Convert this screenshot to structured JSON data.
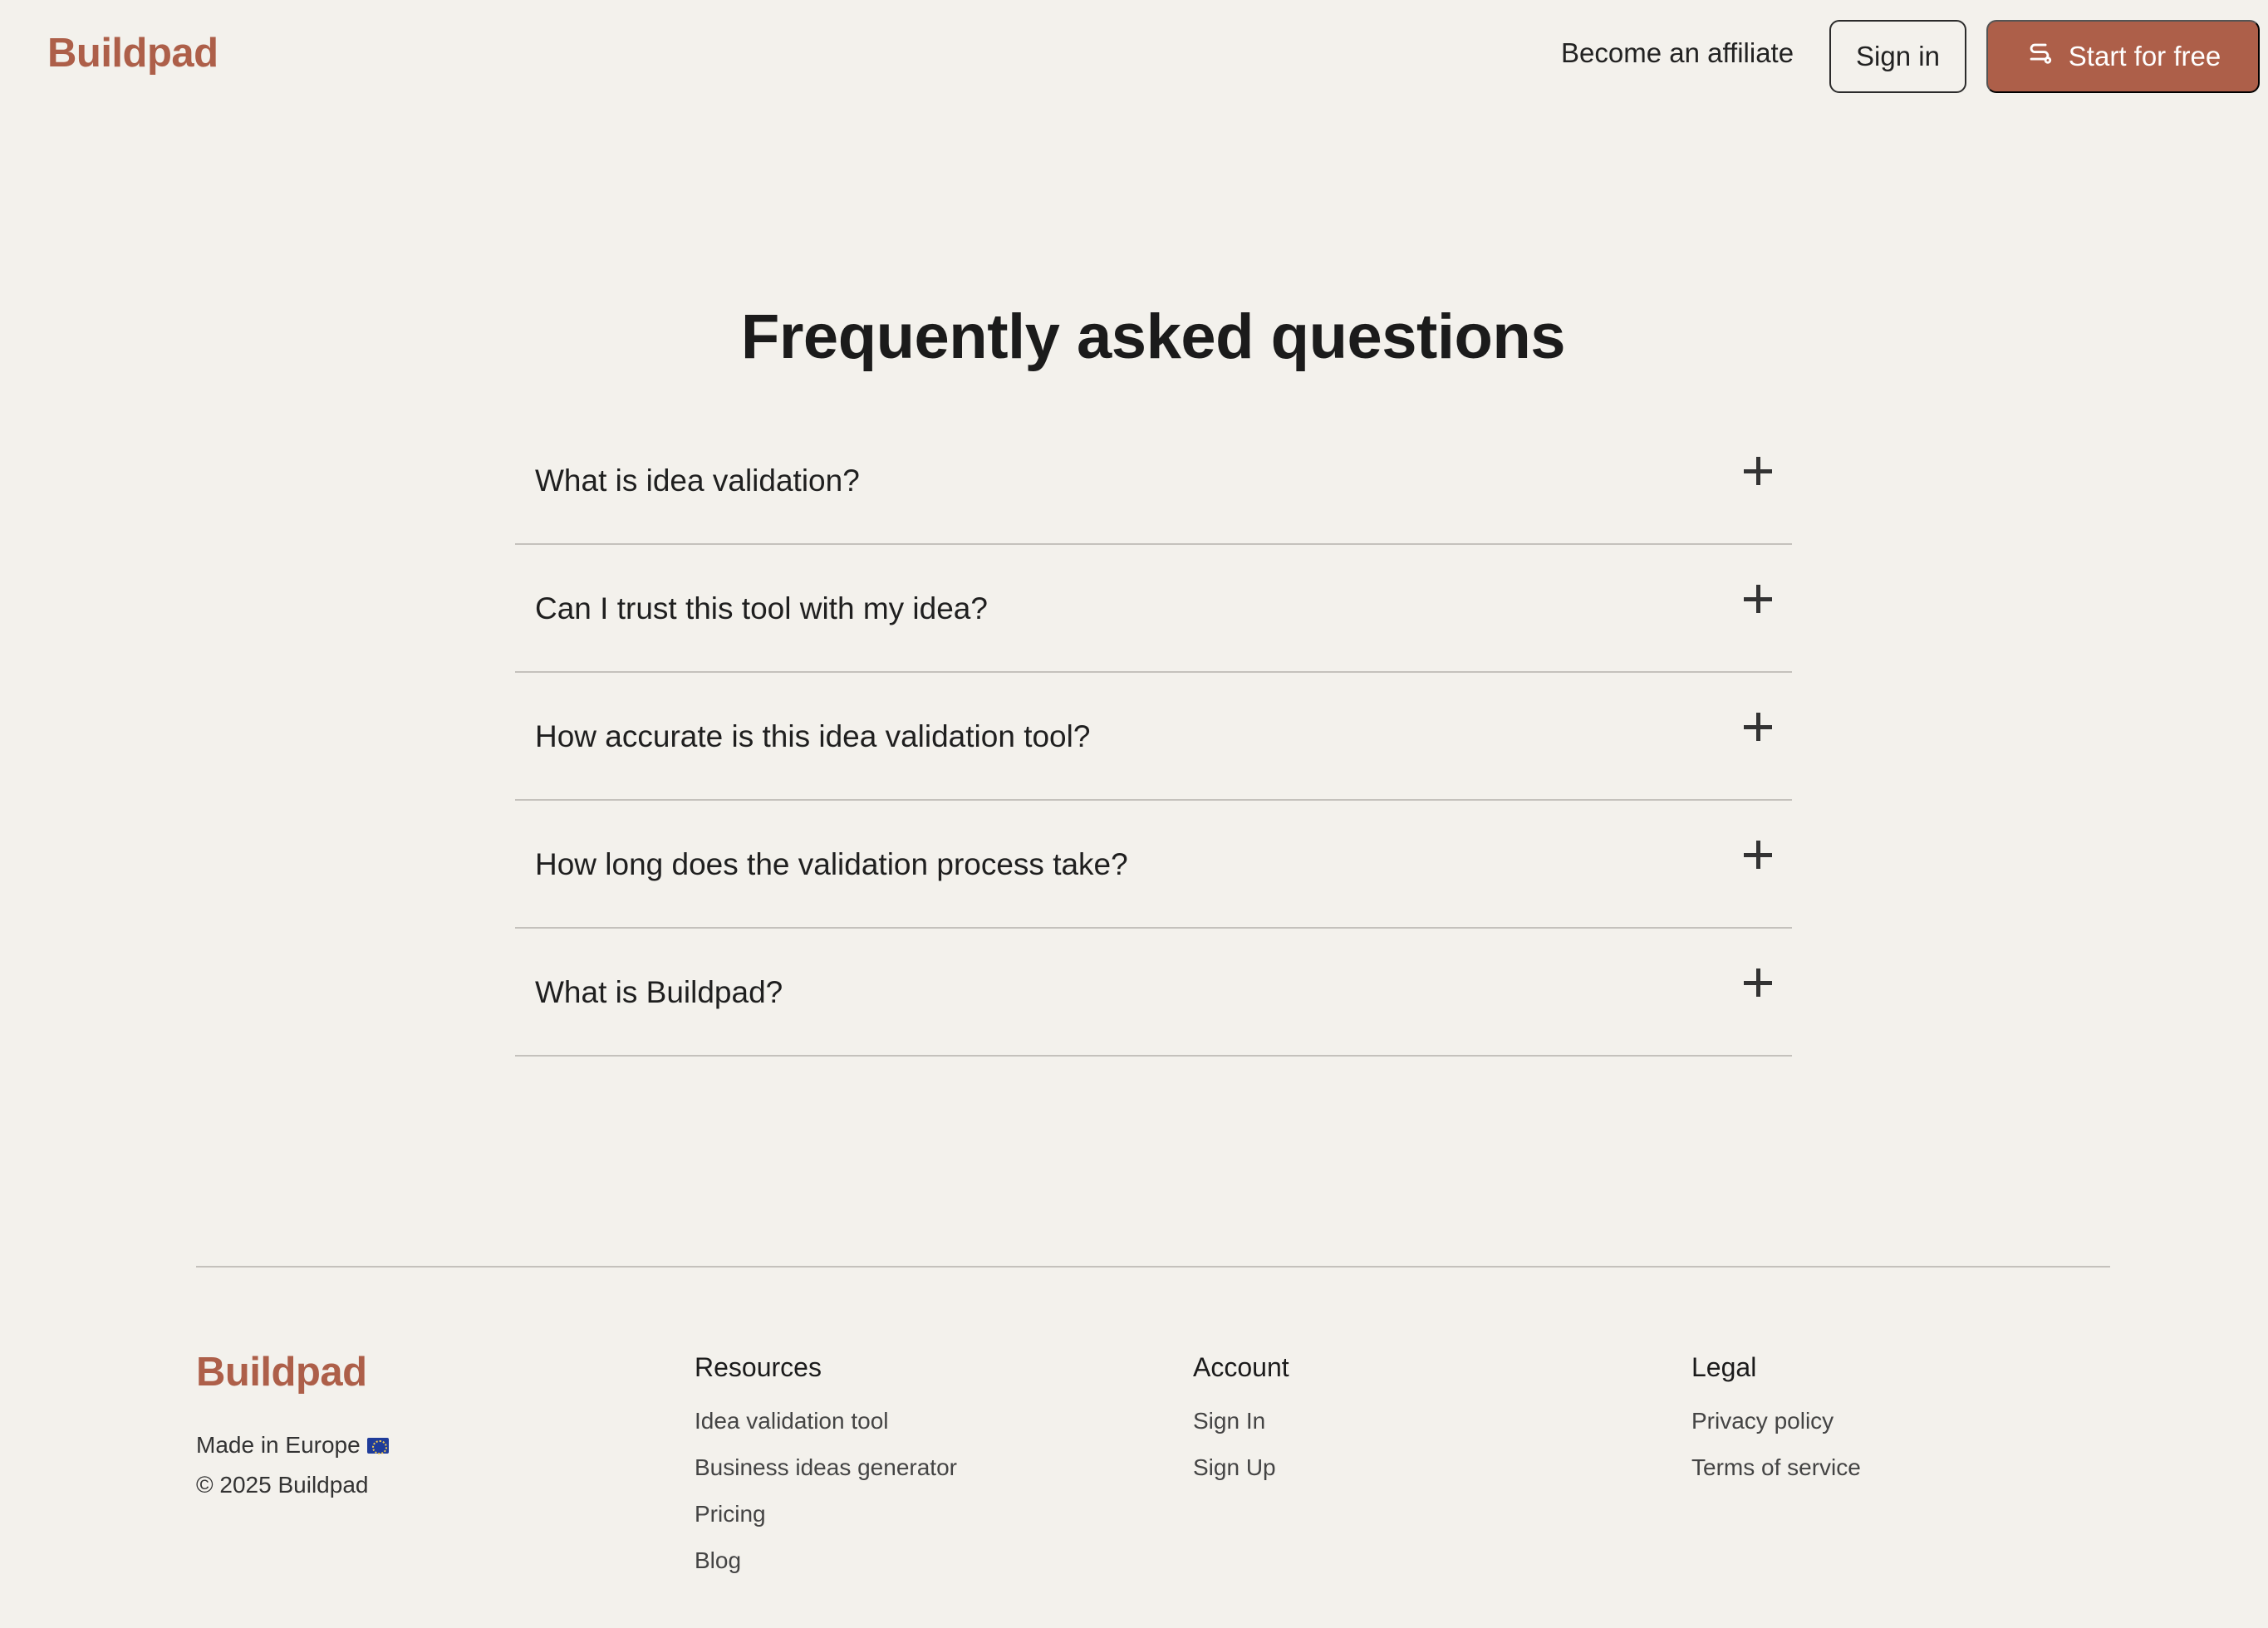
{
  "header": {
    "logo": "Buildpad",
    "affiliate_link": "Become an affiliate",
    "signin_label": "Sign in",
    "start_label": "Start for free",
    "start_icon": "route-icon"
  },
  "faq": {
    "title": "Frequently asked questions",
    "items": [
      {
        "question": "What is idea validation?"
      },
      {
        "question": "Can I trust this tool with my idea?"
      },
      {
        "question": "How accurate is this idea validation tool?"
      },
      {
        "question": "How long does the validation process take?"
      },
      {
        "question": "What is Buildpad?"
      }
    ]
  },
  "footer": {
    "logo": "Buildpad",
    "made_in": "Made in Europe",
    "copyright": "© 2025 Buildpad",
    "resources": {
      "title": "Resources",
      "links": [
        "Idea validation tool",
        "Business ideas generator",
        "Pricing",
        "Blog"
      ]
    },
    "account": {
      "title": "Account",
      "links": [
        "Sign In",
        "Sign Up"
      ]
    },
    "legal": {
      "title": "Legal",
      "links": [
        "Privacy policy",
        "Terms of service"
      ]
    }
  },
  "colors": {
    "brand": "#ad5f49",
    "background": "#f3f1ec",
    "divider": "#c4c1bc"
  }
}
